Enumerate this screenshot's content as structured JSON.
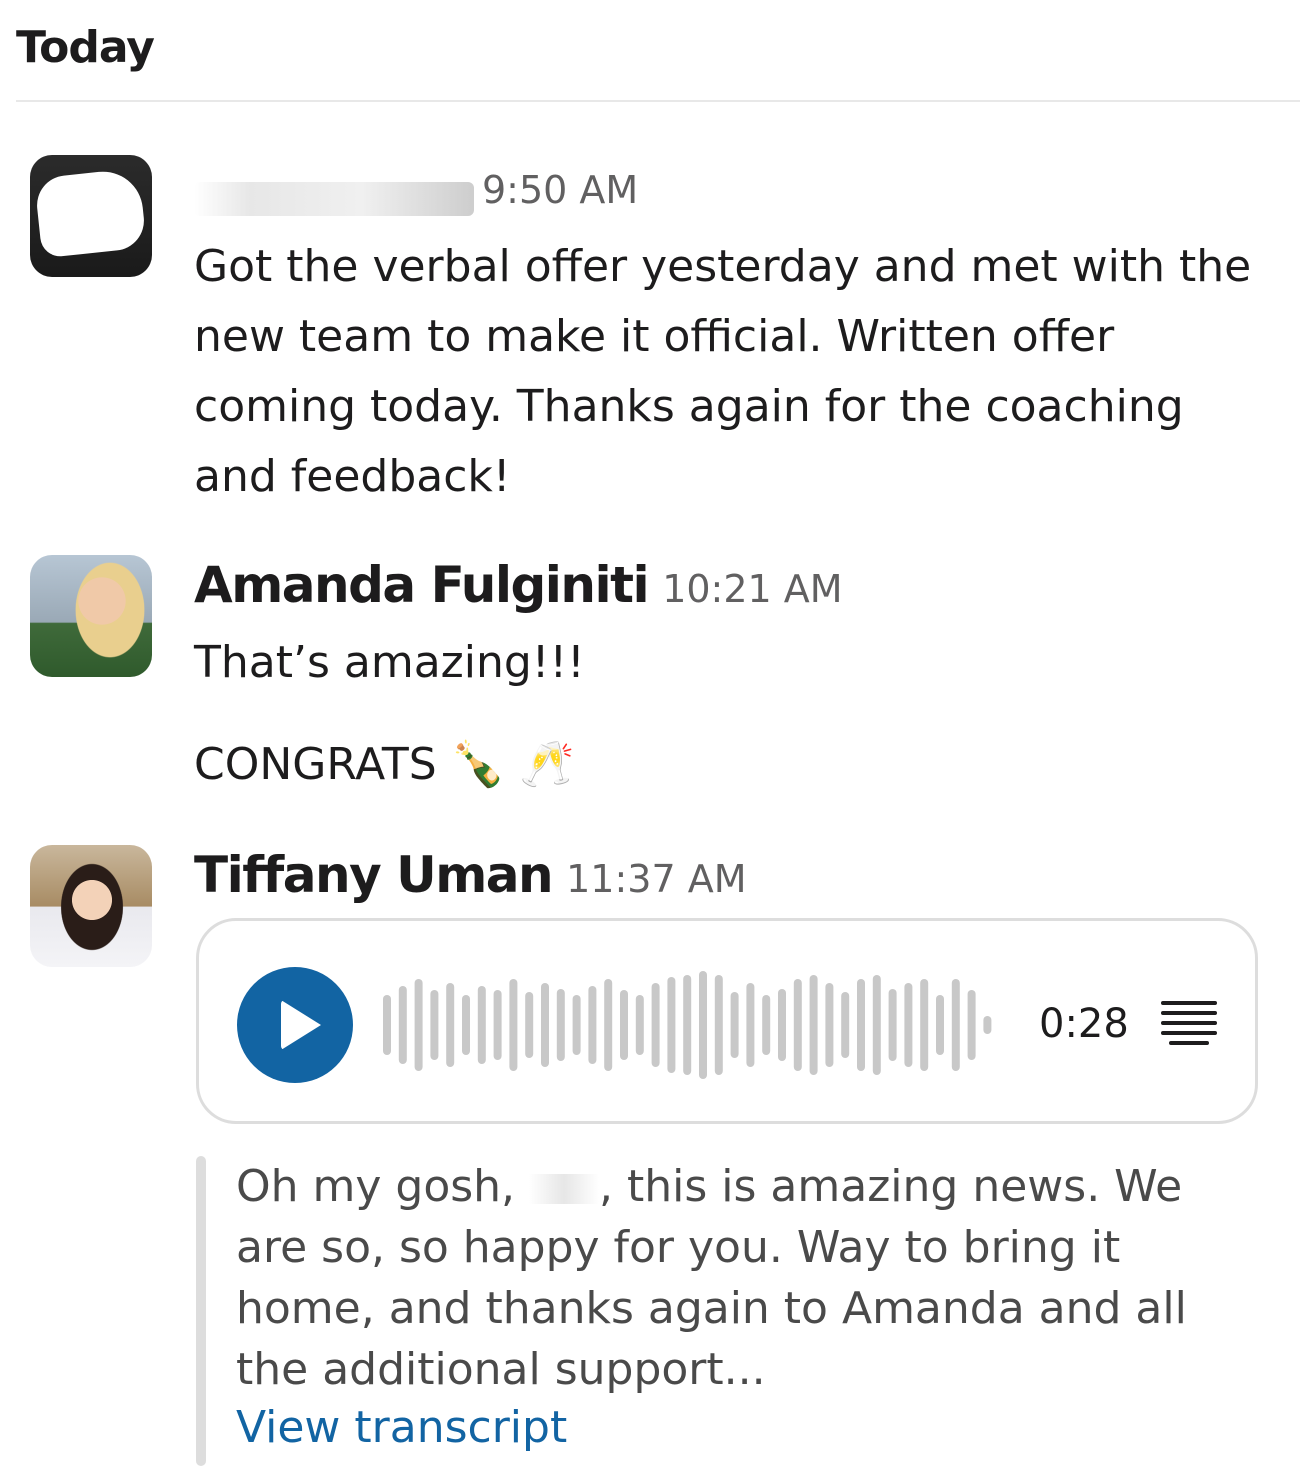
{
  "day_header": "Today",
  "messages": [
    {
      "author": "",
      "time": "9:50 AM",
      "text": "Got the verbal offer yesterday and met with the new team to make it official. Written offer coming today. Thanks again for the coaching and feedback!"
    },
    {
      "author": "Amanda Fulginiti",
      "time": "10:21 AM",
      "text_line1": "That’s amazing!!!",
      "text_line2": "CONGRATS",
      "emojis": [
        "🍾",
        "🥂"
      ]
    },
    {
      "author": "Tiffany Uman",
      "time": "11:37 AM",
      "audio": {
        "duration": "0:28",
        "play_icon": "play-icon",
        "transcript_icon": "transcript-lines-icon",
        "accent_color": "#1264a3"
      },
      "transcript_part1": "Oh my gosh,",
      "transcript_part2": ", this is amazing news. We are so, so happy for you. Way to bring it home, and thanks again to Amanda and all the additional support...",
      "view_transcript_label": "View transcript"
    }
  ]
}
